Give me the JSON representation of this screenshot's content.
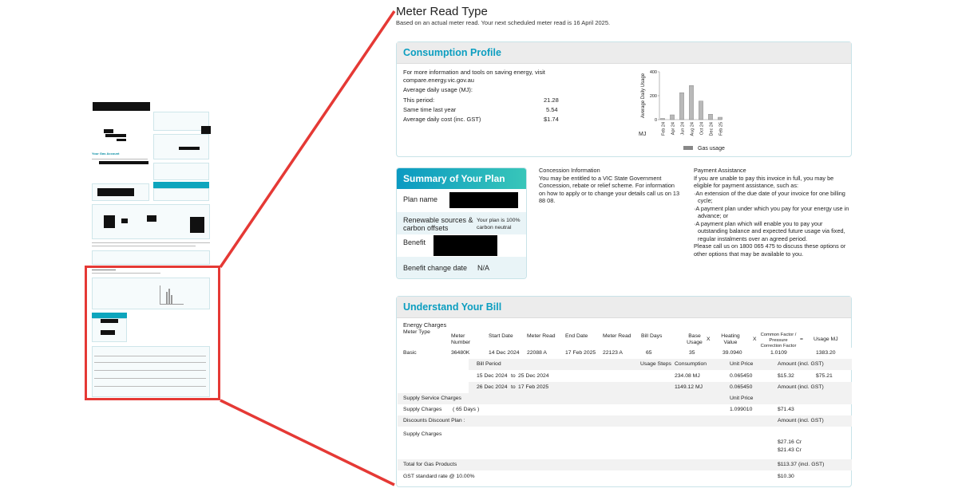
{
  "thumbnail": {
    "your_gas_account": "Your Gas Account"
  },
  "meter_read": {
    "title": "Meter Read Type",
    "subtitle": "Based on an actual meter read. Your next scheduled meter read is 16 April 2025."
  },
  "consumption": {
    "title": "Consumption Profile",
    "info": "For more information and tools on saving energy, visit compare.energy.vic.gov.au",
    "avg_label": "Average daily usage (MJ):",
    "rows": [
      {
        "label": "This period:",
        "value": "21.28"
      },
      {
        "label": "Same time last year",
        "value": "5.54"
      },
      {
        "label": "Average daily cost (inc. GST)",
        "value": "$1.74"
      }
    ]
  },
  "chart_data": {
    "type": "bar",
    "categories": [
      "Feb 24",
      "Apr 24",
      "Jun 24",
      "Aug 24",
      "Oct 24",
      "Dec 24",
      "Feb 25"
    ],
    "values": [
      10,
      40,
      225,
      285,
      155,
      45,
      20
    ],
    "ylabel": "Average Daily Usage",
    "unit_label": "MJ",
    "ylim": [
      0,
      400
    ],
    "yticks": [
      0,
      200,
      400
    ],
    "legend": "Gas usage",
    "bar_color": "#b9b9b9"
  },
  "summary": {
    "title": "Summary of Your Plan",
    "plan_name_label": "Plan name",
    "renewable_label": "Renewable sources & carbon offsets",
    "renewable_value": "Your plan is 100% carbon neutral",
    "benefit_label": "Benefit",
    "benefit_change_label": "Benefit change date",
    "benefit_change_value": "N/A"
  },
  "concession": {
    "title": "Concession Information",
    "body": "You may be entitled to a VIC State Government Concession, rebate or relief scheme. For information on how to apply or to change your details call us on 13 88 08."
  },
  "payment": {
    "title": "Payment Assistance",
    "intro": "If you are unable to pay this invoice in full, you may be eligible for payment assistance, such as:",
    "items": [
      "·An extension of the due date of your invoice for one billing cycle;",
      "·A payment plan under which you pay for your energy use in advance; or",
      "·A payment plan which will enable you to pay your outstanding balance and expected future usage via fixed, regular instalments over an agreed period."
    ],
    "outro": "Please call us on 1800 065 475 to discuss these options or other options that may be available to you."
  },
  "bill": {
    "title": "Understand Your Bill",
    "section": "Energy Charges",
    "headers": {
      "meter_type": "Meter Type",
      "meter_number": "Meter Number",
      "start_date": "Start Date",
      "meter_read1": "Meter Read",
      "end_date": "End Date",
      "meter_read2": "Meter Read",
      "bill_days": "Bill Days",
      "base_usage": "Base Usage",
      "x1": "X",
      "heating_value": "Heating Value",
      "x2": "X",
      "common_factor": "Common Factor / Pressure Correction Factor",
      "eq": "=",
      "usage_mj": "Usage MJ"
    },
    "basic": {
      "type": "Basic",
      "number": "36480K",
      "start": "14 Dec 2024",
      "read1": "22088 A",
      "end": "17 Feb 2025",
      "read2": "22123 A",
      "days": "65",
      "base": "35",
      "heating": "39.0940",
      "factor": "1.0109",
      "usage": "1383.20"
    },
    "period_headers": {
      "bill_period": "Bill Period",
      "usage_steps": "Usage Steps",
      "consumption": "Consumption",
      "unit_price": "Unit Price",
      "amount": "Amount (incl. GST)"
    },
    "periods": [
      {
        "from": "15 Dec 2024",
        "to_word": "to",
        "to": "25 Dec 2024",
        "consumption": "234.08 MJ",
        "unit": "0.065450",
        "amount": "$15.32",
        "subtotal": "$75.21"
      },
      {
        "from": "26 Dec 2024",
        "to_word": "to",
        "to": "17 Feb 2025",
        "consumption": "1149.12 MJ",
        "unit": "0.065450",
        "amount": "Amount (incl. GST)",
        "subtotal": ""
      }
    ],
    "supply_service": "Supply Service Charges",
    "supply_unit_price": "Unit Price",
    "supply_charges": "Supply Charges",
    "supply_days": "( 65 Days )",
    "supply_rate": "1.099010",
    "supply_amount": "$71.43",
    "discounts": "Discounts Discount Plan :",
    "discount_amount_label": "Amount (incl. GST)",
    "supply_charges2": "Supply Charges",
    "credit1": "$27.16",
    "credit1_cr": "Cr",
    "credit2": "$21.43 Cr",
    "total_label": "Total for Gas Products",
    "total_value": "$113.37 (incl. GST)",
    "gst_label": "GST standard rate @ 10.00%",
    "gst_value": "$10.30"
  }
}
